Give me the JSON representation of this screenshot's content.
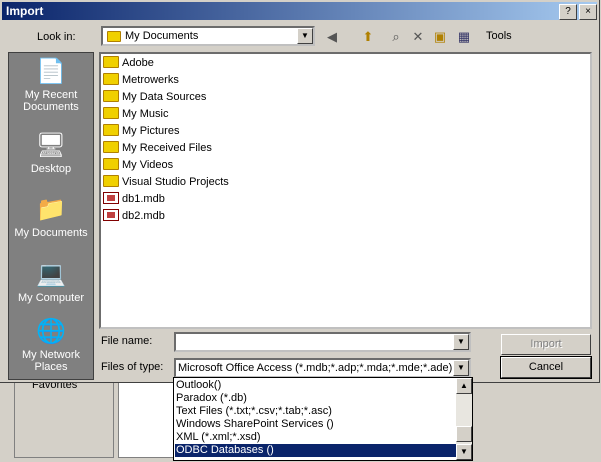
{
  "dialog": {
    "title": "Import",
    "help": "?",
    "close": "×"
  },
  "lookin": {
    "label": "Look in:",
    "value": "My Documents"
  },
  "toolbar": {
    "tools_label": "Tools"
  },
  "places": [
    {
      "label": "My Recent Documents",
      "icon": "recent-documents-icon"
    },
    {
      "label": "Desktop",
      "icon": "desktop-icon"
    },
    {
      "label": "My Documents",
      "icon": "my-documents-icon"
    },
    {
      "label": "My Computer",
      "icon": "my-computer-icon"
    },
    {
      "label": "My Network Places",
      "icon": "network-places-icon"
    }
  ],
  "files": [
    {
      "name": "Adobe",
      "type": "folder"
    },
    {
      "name": "Metrowerks",
      "type": "folder"
    },
    {
      "name": "My Data Sources",
      "type": "folder"
    },
    {
      "name": "My Music",
      "type": "folder"
    },
    {
      "name": "My Pictures",
      "type": "folder"
    },
    {
      "name": "My Received Files",
      "type": "folder"
    },
    {
      "name": "My Videos",
      "type": "folder"
    },
    {
      "name": "Visual Studio Projects",
      "type": "folder"
    },
    {
      "name": "db1.mdb",
      "type": "mdb"
    },
    {
      "name": "db2.mdb",
      "type": "mdb"
    }
  ],
  "filename": {
    "label": "File name:",
    "value": ""
  },
  "filetype": {
    "label": "Files of type:",
    "value": "Microsoft Office Access (*.mdb;*.adp;*.mda;*.mde;*.ade)"
  },
  "buttons": {
    "import": "Import",
    "cancel": "Cancel"
  },
  "type_options": [
    "Outlook()",
    "Paradox (*.db)",
    "Text Files (*.txt;*.csv;*.tab;*.asc)",
    "Windows SharePoint Services ()",
    "XML (*.xml;*.xsd)",
    "ODBC Databases ()"
  ],
  "selected_option_index": 5,
  "background": {
    "favorites": "Favorites"
  },
  "colors": {
    "titlebar": "#0a246a",
    "selection": "#0a246a",
    "places_bg": "#808080"
  }
}
